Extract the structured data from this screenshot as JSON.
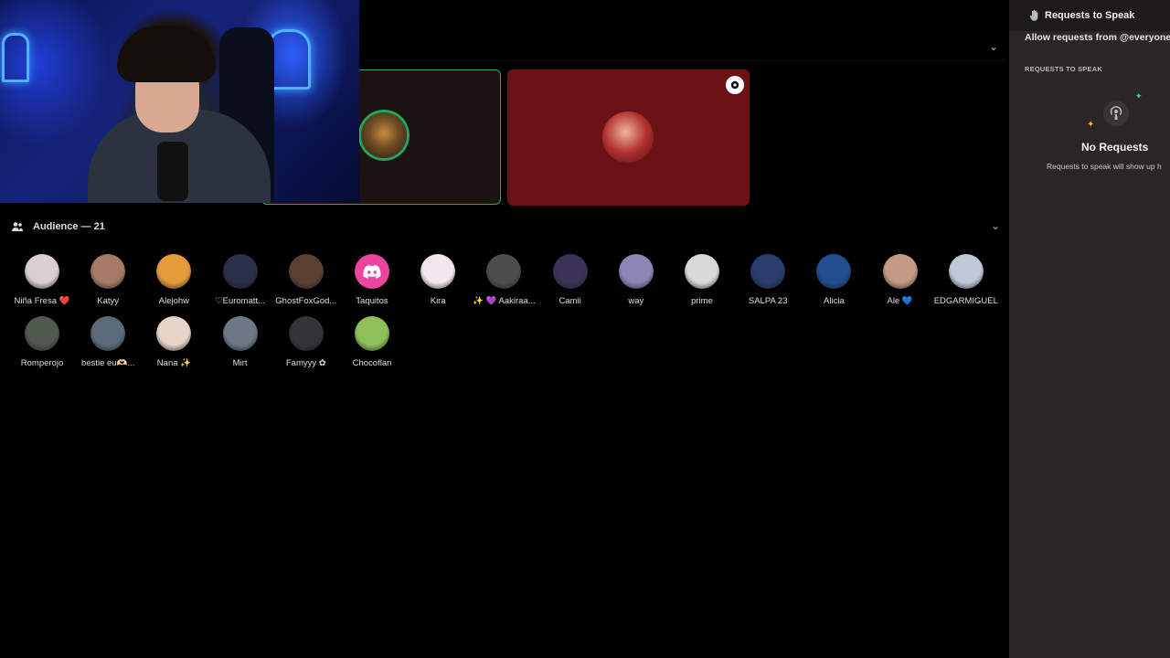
{
  "stage": {
    "audience_label": "Audience — 21"
  },
  "audience": [
    {
      "name": "Niña Fresa ❤️",
      "color": "#d8cfd0"
    },
    {
      "name": "Katyy",
      "color": "#a67a66"
    },
    {
      "name": "Alejohw",
      "color": "#e59a3a"
    },
    {
      "name": "♡Euromatt...",
      "color": "#2b2f4a",
      "status_dot": "#c39bd3"
    },
    {
      "name": "GhostFoxGod...",
      "color": "#5a4030"
    },
    {
      "name": "Taquitos",
      "color": "#eb459e",
      "icon": "discord-logo-icon"
    },
    {
      "name": "Kira",
      "color": "#f1e8ee"
    },
    {
      "name": "✨ 💜 Aakiraa...",
      "color": "#4d4d4d"
    },
    {
      "name": "Camii",
      "color": "#3b3358"
    },
    {
      "name": "way",
      "color": "#8b86b5"
    },
    {
      "name": "prime",
      "color": "#d9d9d9"
    },
    {
      "name": "SALPA 23",
      "color": "#2a3c6b"
    },
    {
      "name": "Alicia",
      "color": "#1f4f8f"
    },
    {
      "name": "Ale 💙",
      "color": "#c39a84"
    },
    {
      "name": "EDGARMIGUEL",
      "color": "#c0c7d6"
    },
    {
      "name": "Romperojo",
      "color": "#4e5a4b"
    },
    {
      "name": "bestie eu🫶🏻...",
      "color": "#5c6b7a"
    },
    {
      "name": "Nana ✨",
      "color": "#e8d4c8"
    },
    {
      "name": "Mirt",
      "color": "#6d7786"
    },
    {
      "name": "Famyyy ✿",
      "color": "#333338",
      "status_dot": "#c39bd3"
    },
    {
      "name": "Chocoflan",
      "color": "#8ec05a"
    }
  ],
  "sidebar": {
    "title": "Requests to Speak",
    "allow_text": "Allow requests from @everyone",
    "section": "REQUESTS TO SPEAK",
    "empty_title": "No Requests",
    "empty_desc": "Requests to speak will show up h"
  },
  "colors": {
    "speaking_ring": "#23a55a",
    "red_tile": "#6b1214",
    "sidebar_bg": "#2b2527"
  }
}
